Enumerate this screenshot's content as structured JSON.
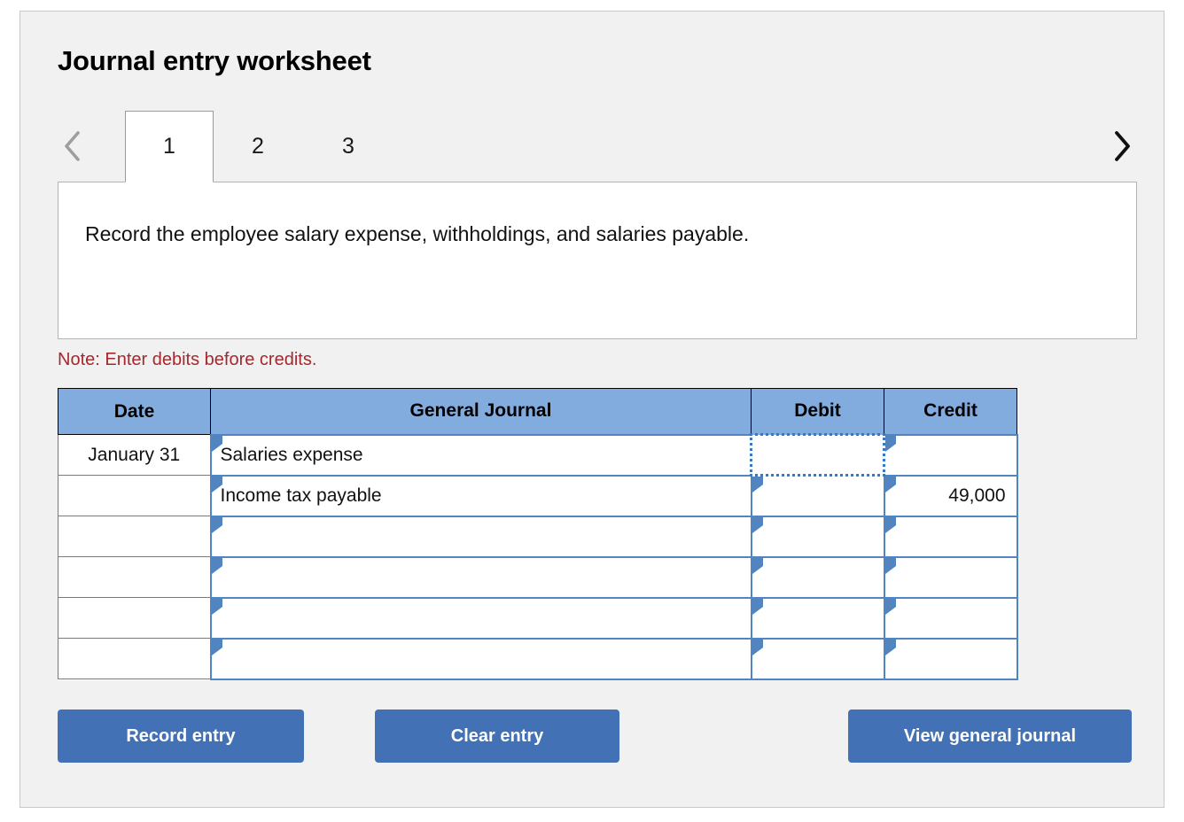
{
  "page": {
    "title": "Journal entry worksheet",
    "background": "#f1f1f1",
    "accent_blue": "#4271b5",
    "header_blue": "#82abde",
    "cell_border_blue": "#5284bf",
    "note_red": "#a6282c"
  },
  "tabs": {
    "prev_icon": "chevron-left-icon",
    "next_icon": "chevron-right-icon",
    "items": [
      {
        "label": "1",
        "active": true
      },
      {
        "label": "2",
        "active": false
      },
      {
        "label": "3",
        "active": false
      }
    ]
  },
  "instruction": {
    "text": "Record the employee salary expense, withholdings, and salaries payable."
  },
  "note": {
    "text": "Note: Enter debits before credits."
  },
  "table": {
    "headers": {
      "date": "Date",
      "general_journal": "General Journal",
      "debit": "Debit",
      "credit": "Credit"
    },
    "rows": [
      {
        "date": "January 31",
        "account": "Salaries expense",
        "indent": 0,
        "debit": "",
        "credit": "",
        "debit_selected": true
      },
      {
        "date": "",
        "account": "Income tax payable",
        "indent": 1,
        "debit": "",
        "credit": "49,000",
        "debit_selected": false
      },
      {
        "date": "",
        "account": "",
        "indent": 0,
        "debit": "",
        "credit": "",
        "debit_selected": false
      },
      {
        "date": "",
        "account": "",
        "indent": 0,
        "debit": "",
        "credit": "",
        "debit_selected": false
      },
      {
        "date": "",
        "account": "",
        "indent": 0,
        "debit": "",
        "credit": "",
        "debit_selected": false
      },
      {
        "date": "",
        "account": "",
        "indent": 0,
        "debit": "",
        "credit": "",
        "debit_selected": false
      }
    ]
  },
  "buttons": {
    "record": "Record entry",
    "clear": "Clear entry",
    "view": "View general journal"
  }
}
